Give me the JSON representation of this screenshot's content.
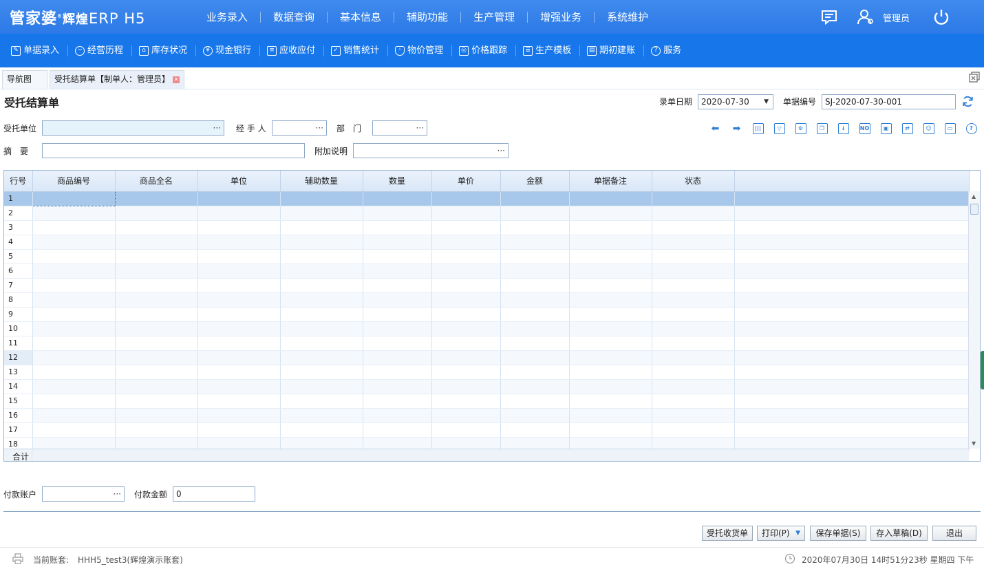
{
  "app": {
    "logo_main": "管家婆",
    "logo_sub": "辉煌",
    "logo_erp": "ERP H5",
    "user": "管理员"
  },
  "main_nav": [
    "业务录入",
    "数据查询",
    "基本信息",
    "辅助功能",
    "生产管理",
    "增强业务",
    "系统维护"
  ],
  "sub_nav": [
    {
      "label": "单据录入",
      "icon": "edit-icon"
    },
    {
      "label": "经营历程",
      "icon": "chart-icon"
    },
    {
      "label": "库存状况",
      "icon": "warehouse-icon"
    },
    {
      "label": "现金银行",
      "icon": "yuan-icon"
    },
    {
      "label": "应收应付",
      "icon": "ledger-icon"
    },
    {
      "label": "销售统计",
      "icon": "stats-icon"
    },
    {
      "label": "物价管理",
      "icon": "shield-icon"
    },
    {
      "label": "价格跟踪",
      "icon": "track-icon"
    },
    {
      "label": "生产模板",
      "icon": "template-icon"
    },
    {
      "label": "期初建账",
      "icon": "book-icon"
    },
    {
      "label": "服务",
      "icon": "help-icon"
    }
  ],
  "tabs": {
    "nav": "导航图",
    "active": "受托结算单【制单人：管理员】"
  },
  "form": {
    "title": "受托结算单",
    "date_label": "录单日期",
    "date_value": "2020-07-30",
    "number_label": "单据编号",
    "number_value": "SJ-2020-07-30-001",
    "unit_label": "受托单位",
    "handler_label": "经 手 人",
    "dept_label": "部　门",
    "summary_label": "摘　要",
    "extra_label": "附加说明",
    "dots": "···"
  },
  "grid": {
    "columns": [
      "行号",
      "商品编号",
      "商品全名",
      "单位",
      "辅助数量",
      "数量",
      "单价",
      "金额",
      "单据备注",
      "状态"
    ],
    "rows": [
      "1",
      "2",
      "3",
      "4",
      "5",
      "6",
      "7",
      "8",
      "9",
      "10",
      "11",
      "12",
      "13",
      "14",
      "15",
      "16",
      "17",
      "18"
    ],
    "sum_label": "合计"
  },
  "payment": {
    "account_label": "付款账户",
    "amount_label": "付款金额",
    "amount_value": "0"
  },
  "buttons": {
    "receive": "受托收货单",
    "print": "打印(P)",
    "save": "保存单据(S)",
    "draft": "存入草稿(D)",
    "exit": "退出"
  },
  "status": {
    "account_label": "当前账套:",
    "account_value": "HHH5_test3(辉煌演示账套)",
    "datetime": "2020年07月30日 14时51分23秒 星期四 下午"
  },
  "colors": {
    "topbar": "#2d79e6",
    "subbar": "#1676ea",
    "selected_row": "#a7c8ea"
  }
}
